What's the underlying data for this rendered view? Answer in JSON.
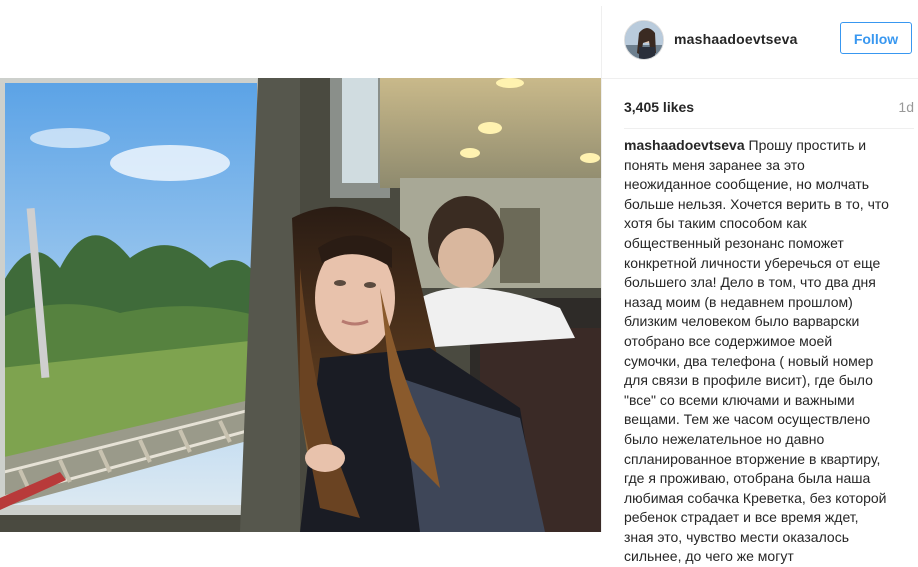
{
  "post": {
    "username": "mashaadoevtseva",
    "follow_label": "Follow",
    "likes": "3,405 likes",
    "time": "1d",
    "caption": "Прошу простить и понять меня заранее за это неожиданное сообщение, но молчать больше нельзя. Хочется верить в то, что хотя бы таким способом как общественный резонанс поможет конкретной личности уберечься от еще большего зла! Дело в том, что два дня назад моим (в недавнем прошлом) близким человеком было варварски отобрано все содержимое моей сумочки, два телефона ( новый номер для связи в профиле висит), где было \"все\" со всеми ключами и важными вещами. Тем же часом осуществлено было нежелательное но давно спланированное вторжение в квартиру, где я проживаю, отобрана была наша любимая собачка Креветка, без которой ребенок страдает и все время ждет, зная это, чувство мести оказалось сильнее, до чего же могут"
  },
  "icons": {
    "avatar": "profile-avatar",
    "photo": "train-window-photo"
  },
  "colors": {
    "follow": "#3897f0",
    "text": "#262626",
    "muted": "#999999"
  }
}
